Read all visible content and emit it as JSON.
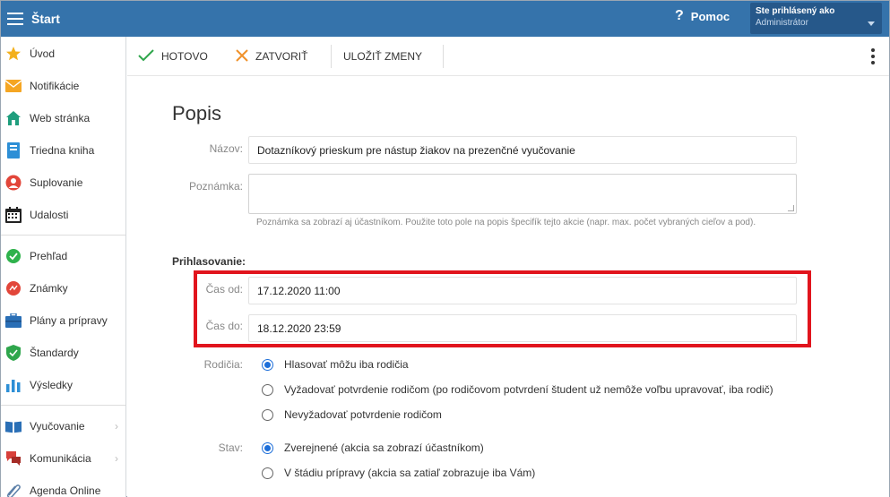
{
  "topbar": {
    "title": "Štart",
    "help_label": "Pomoc",
    "help_icon": "?",
    "user_line1": "Ste prihlásený ako",
    "user_line2": "Administrátor"
  },
  "sidebar": {
    "items": [
      {
        "label": "Úvod",
        "icon": "star-icon"
      },
      {
        "label": "Notifikácie",
        "icon": "envelope-icon"
      },
      {
        "label": "Web stránka",
        "icon": "house-icon"
      },
      {
        "label": "Triedna kniha",
        "icon": "book-icon"
      },
      {
        "label": "Suplovanie",
        "icon": "person-icon"
      },
      {
        "label": "Udalosti",
        "icon": "calendar-icon"
      },
      {
        "label": "Prehľad",
        "icon": "check-circle-icon"
      },
      {
        "label": "Známky",
        "icon": "grades-icon"
      },
      {
        "label": "Plány a prípravy",
        "icon": "briefcase-icon"
      },
      {
        "label": "Štandardy",
        "icon": "shield-icon"
      },
      {
        "label": "Výsledky",
        "icon": "bar-chart-icon"
      },
      {
        "label": "Vyučovanie",
        "icon": "open-book-icon",
        "chevron": "›"
      },
      {
        "label": "Komunikácia",
        "icon": "chat-icon",
        "chevron": "›"
      },
      {
        "label": "Agenda Online",
        "icon": "paperclip-icon"
      }
    ]
  },
  "toolbar": {
    "done_label": "HOTOVO",
    "close_label": "ZATVORIŤ",
    "save_label": "ULOŽIŤ ZMENY"
  },
  "form": {
    "title": "Popis",
    "name_label": "Názov:",
    "name_value": "Dotazníkový prieskum pre nástup žiakov na prezenčné vyučovanie",
    "note_label": "Poznámka:",
    "note_value": "",
    "note_hint": "Poznámka sa zobrazí aj účastníkom. Použite toto pole na popis špecifík tejto akcie (napr. max. počet vybraných cieľov a pod).",
    "signup_heading": "Prihlasovanie:",
    "time_from_label": "Čas od:",
    "time_from_value": "17.12.2020 11:00",
    "time_to_label": "Čas do:",
    "time_to_value": "18.12.2020 23:59",
    "parents_label": "Rodičia:",
    "parents_options": [
      {
        "label": "Hlasovať môžu iba rodičia",
        "selected": true
      },
      {
        "label": "Vyžadovať potvrdenie rodičom (po rodičovom potvrdení študent už nemôže voľbu upravovať, iba rodič)",
        "selected": false
      },
      {
        "label": "Nevyžadovať potvrdenie rodičom",
        "selected": false
      }
    ],
    "state_label": "Stav:",
    "state_options": [
      {
        "label": "Zverejnené (akcia sa zobrazí účastníkom)",
        "selected": true
      },
      {
        "label": "V štádiu prípravy (akcia sa zatiaľ zobrazuje iba Vám)",
        "selected": false
      }
    ]
  },
  "colors": {
    "topbar": "#3573ab",
    "user_box": "#26588a",
    "highlight": "#e1141d",
    "radio_selected": "#1e6fd9"
  }
}
